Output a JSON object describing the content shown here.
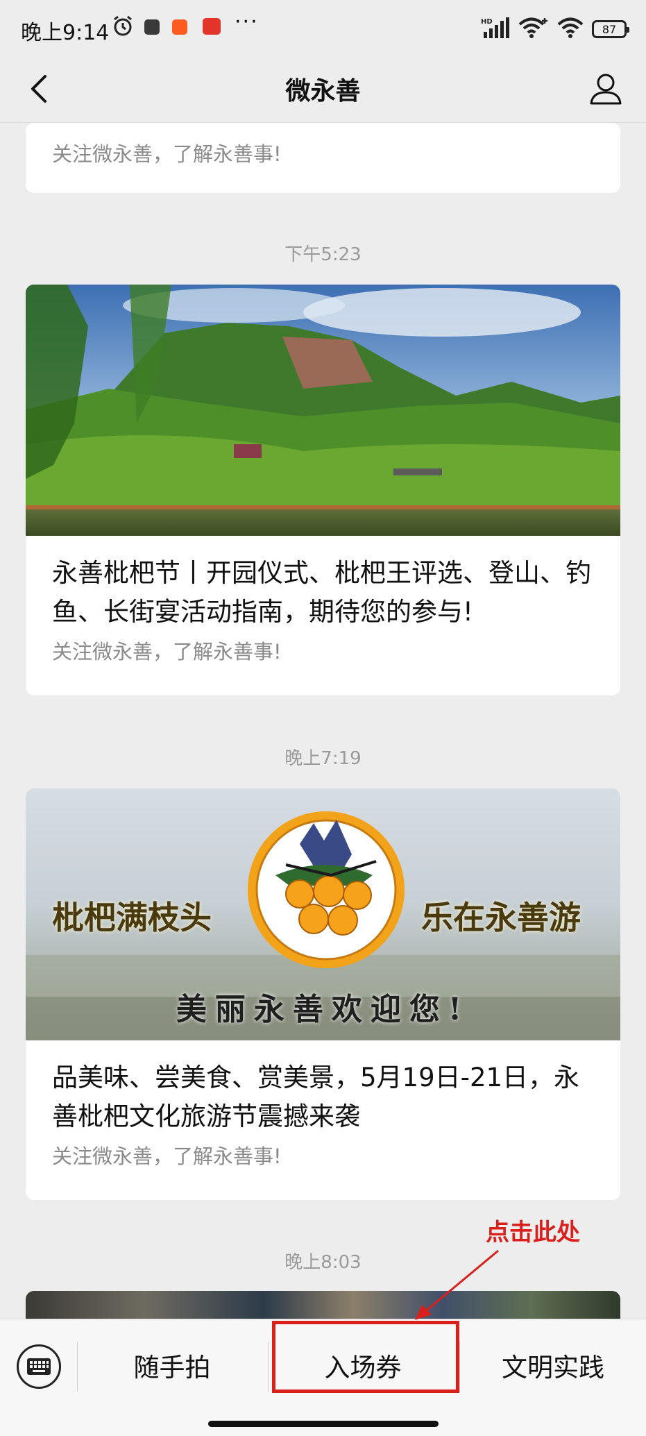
{
  "status_bar": {
    "time": "晚上9:14",
    "more": "···",
    "network": "HD",
    "battery": "87"
  },
  "nav": {
    "title": "微永善"
  },
  "feed": {
    "card0": {
      "subtitle": "关注微永善，了解永善事!"
    },
    "time1": "下午5:23",
    "card1": {
      "title": "永善枇杷节丨开园仪式、枇杷王评选、登山、钓鱼、长街宴活动指南，期待您的参与!",
      "subtitle": "关注微永善，了解永善事!"
    },
    "time2": "晚上7:19",
    "card2": {
      "banner_left": "枇杷满枝头",
      "banner_right": "乐在永善游",
      "banner_bottom": "美丽永善欢迎您!",
      "title": "品美味、尝美食、赏美景，5月19日-21日，永善枇杷文化旅游节震撼来袭",
      "subtitle": "关注微永善，了解永善事!"
    },
    "time3": "晚上8:03"
  },
  "bottom_menu": {
    "items": [
      "随手拍",
      "入场券",
      "文明实践"
    ]
  },
  "annotation": {
    "label": "点击此处",
    "color": "#d9201c"
  }
}
